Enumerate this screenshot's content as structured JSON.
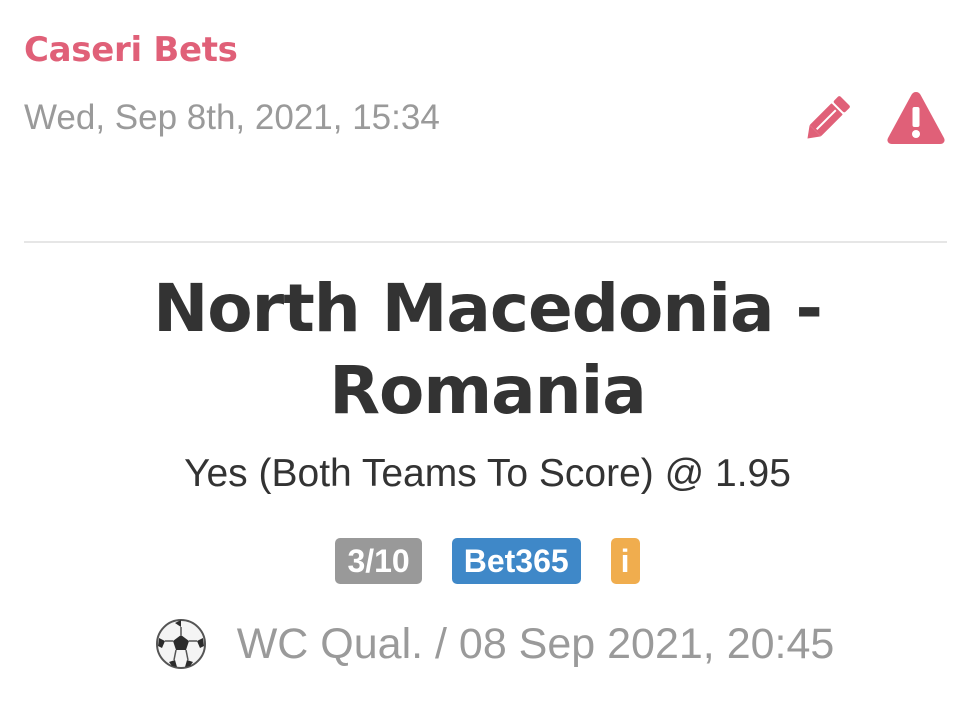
{
  "tip": {
    "tipster_name": "Caseri Bets",
    "posted_at": "Wed, Sep 8th, 2021, 15:34",
    "match": "North Macedonia - Romania",
    "selection": "Yes (Both Teams To Score) @ 1.95",
    "stake_badge": "3/10",
    "bookmaker_badge": "Bet365",
    "info_badge": "i",
    "event_info": "WC Qual. / 08 Sep 2021, 20:45"
  },
  "icons": {
    "edit": "pencil-icon",
    "report": "warning-icon",
    "sport": "soccer-ball-icon"
  },
  "colors": {
    "accent": "#e06078",
    "stake_badge": "#999999",
    "bookmaker_badge": "#3f88c8",
    "info_badge": "#f0ad4e",
    "muted_text": "#9a9a9a",
    "title_text": "#333333"
  }
}
